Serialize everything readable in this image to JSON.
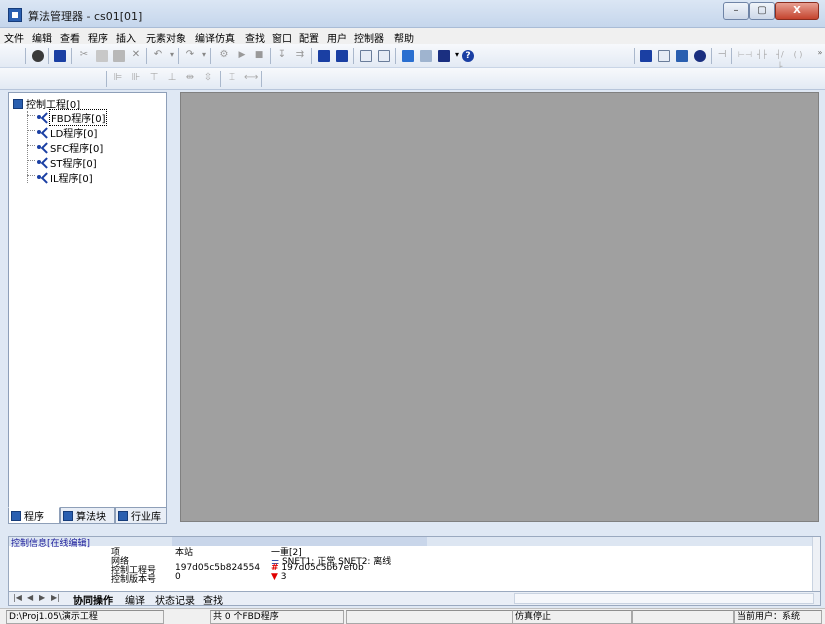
{
  "window": {
    "title": "算法管理器 - cs01[01]",
    "min_symbol": "–",
    "max_symbol": "▢",
    "close_symbol": "X"
  },
  "menu": [
    "文件",
    "编辑",
    "查看",
    "程序",
    "插入",
    "元素对象",
    "编译仿真",
    "查找",
    "窗口",
    "配置",
    "用户",
    "控制器",
    "帮助"
  ],
  "tree": {
    "root": "控制工程[0]",
    "children": [
      "FBD程序[0]",
      "LD程序[0]",
      "SFC程序[0]",
      "ST程序[0]",
      "IL程序[0]"
    ]
  },
  "left_tabs": [
    "程序",
    "算法块",
    "行业库"
  ],
  "info_panel": {
    "title": "控制信息[在线编辑]",
    "columns": [
      "项",
      "本站",
      "一重[2]"
    ],
    "rows": [
      {
        "item": "网络",
        "local": "",
        "remote": "SNET1: 正常 SNET2: 离线"
      },
      {
        "item": "控制工程号",
        "local": "197d05c5b824554",
        "remote": "197d05c5b67ef0b"
      },
      {
        "item": "控制版本号",
        "local": "0",
        "remote": "3"
      }
    ]
  },
  "bottom_tabs": [
    "协同操作",
    "编译",
    "状态记录",
    "查找"
  ],
  "status": {
    "path": "D:\\Proj1.05\\演示工程",
    "count": "共 0 个FBD程序",
    "sim": "仿真停止",
    "user": "当前用户：系统"
  },
  "colors": {
    "accent": "#2a5fb0",
    "workspace": "#a0a0a0",
    "alarm": "#e00000"
  }
}
